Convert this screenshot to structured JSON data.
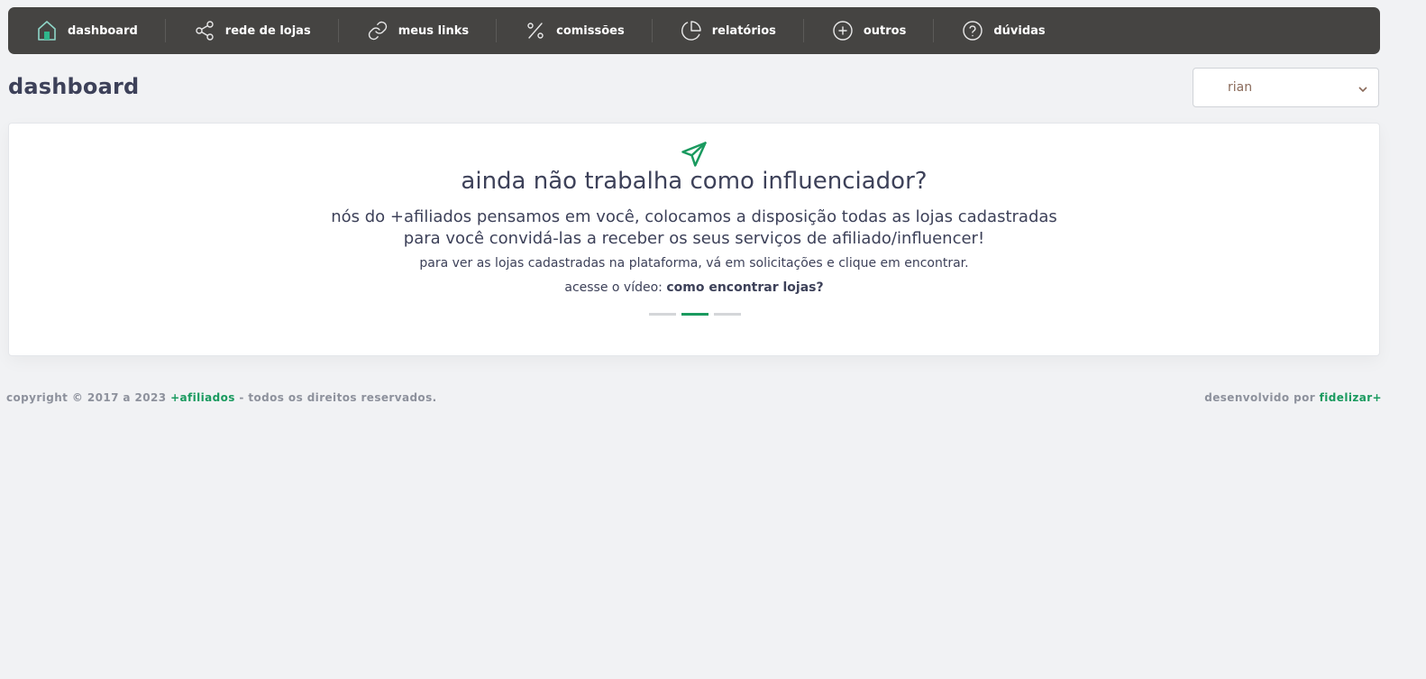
{
  "nav": {
    "items": [
      {
        "label": "dashboard",
        "icon": "home-icon"
      },
      {
        "label": "rede de lojas",
        "icon": "share-icon"
      },
      {
        "label": "meus links",
        "icon": "link-icon"
      },
      {
        "label": "comissões",
        "icon": "percent-icon"
      },
      {
        "label": "relatórios",
        "icon": "pie-chart-icon"
      },
      {
        "label": "outros",
        "icon": "plus-circle-icon"
      },
      {
        "label": "dúvidas",
        "icon": "help-circle-icon"
      }
    ]
  },
  "page": {
    "title": "dashboard"
  },
  "user_select": {
    "value": "rian"
  },
  "card": {
    "icon": "paper-plane-icon",
    "heading": "ainda não trabalha como influenciador?",
    "line1": "nós do +afiliados pensamos em você, colocamos a disposição todas as lojas cadastradas",
    "line2": "para você convidá-las a receber os seus serviços de afiliado/influencer!",
    "line3": "para ver as lojas cadastradas na plataforma, vá em solicitações e clique em encontrar.",
    "video_prefix": "acesse o vídeo: ",
    "video_link": "como encontrar lojas?"
  },
  "carousel": {
    "count": 3,
    "active": 2
  },
  "footer": {
    "copyright_prefix": "copyright © 2017 a 2023 ",
    "brand": "+afiliados",
    "copyright_suffix": " - todos os direitos reservados.",
    "developed_prefix": "desenvolvido por ",
    "developer": "fidelizar+"
  },
  "colors": {
    "nav_bg": "#454442",
    "accent": "#1a9a5f",
    "text": "#3d4159",
    "page_bg": "#f1f2f4"
  }
}
